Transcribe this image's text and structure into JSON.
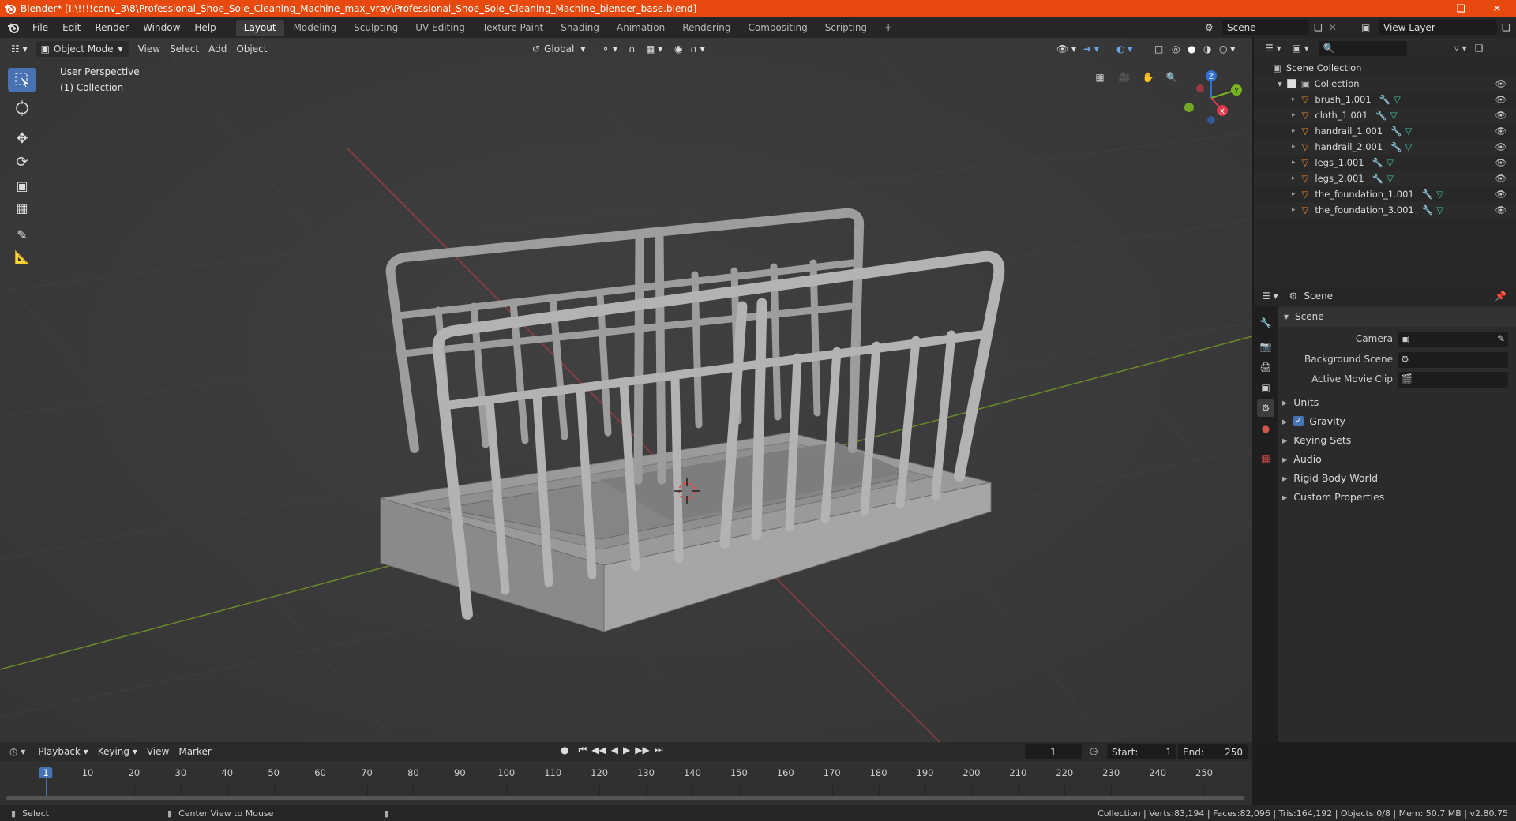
{
  "window": {
    "title": "Blender* [I:\\!!!!conv_3\\8\\Professional_Shoe_Sole_Cleaning_Machine_max_vray\\Professional_Shoe_Sole_Cleaning_Machine_blender_base.blend]",
    "accent": "#e8490f"
  },
  "menu": {
    "items": [
      "File",
      "Edit",
      "Render",
      "Window",
      "Help"
    ],
    "workspaces": [
      "Layout",
      "Modeling",
      "Sculpting",
      "UV Editing",
      "Texture Paint",
      "Shading",
      "Animation",
      "Rendering",
      "Compositing",
      "Scripting"
    ],
    "active_workspace": "Layout",
    "scene": "Scene",
    "view_layer": "View Layer"
  },
  "viewport": {
    "mode": "Object Mode",
    "menus": [
      "View",
      "Select",
      "Add",
      "Object"
    ],
    "orientation": "Global",
    "perspective_label": "User Perspective",
    "collection_label": "(1) Collection",
    "gizmo": {
      "x": "X",
      "y": "Y",
      "z": "Z"
    }
  },
  "outliner": {
    "root": "Scene Collection",
    "collection": "Collection",
    "objects": [
      {
        "name": "brush_1.001"
      },
      {
        "name": "cloth_1.001"
      },
      {
        "name": "handrail_1.001"
      },
      {
        "name": "handrail_2.001"
      },
      {
        "name": "legs_1.001"
      },
      {
        "name": "legs_2.001"
      },
      {
        "name": "the_foundation_1.001"
      },
      {
        "name": "the_foundation_3.001"
      }
    ]
  },
  "properties": {
    "context": "Scene",
    "panel_title": "Scene",
    "camera_label": "Camera",
    "background_scene_label": "Background Scene",
    "active_movie_clip_label": "Active Movie Clip",
    "subpanels": [
      "Units",
      "Gravity",
      "Keying Sets",
      "Audio",
      "Rigid Body World",
      "Custom Properties"
    ],
    "gravity_checked": true
  },
  "timeline": {
    "menus": [
      "Playback",
      "Keying",
      "View",
      "Marker"
    ],
    "current_frame": "1",
    "start_label": "Start:",
    "start": "1",
    "end_label": "End:",
    "end": "250",
    "ticks": [
      "1",
      "10",
      "20",
      "30",
      "40",
      "50",
      "60",
      "70",
      "80",
      "90",
      "100",
      "110",
      "120",
      "130",
      "140",
      "150",
      "160",
      "170",
      "180",
      "190",
      "200",
      "210",
      "220",
      "230",
      "240",
      "250"
    ]
  },
  "status": {
    "left_action": "Select",
    "middle_action": "Center View to Mouse",
    "stats": "Collection | Verts:83,194 | Faces:82,096 | Tris:164,192 | Objects:0/8 | Mem: 50.7 MB | v2.80.75"
  }
}
